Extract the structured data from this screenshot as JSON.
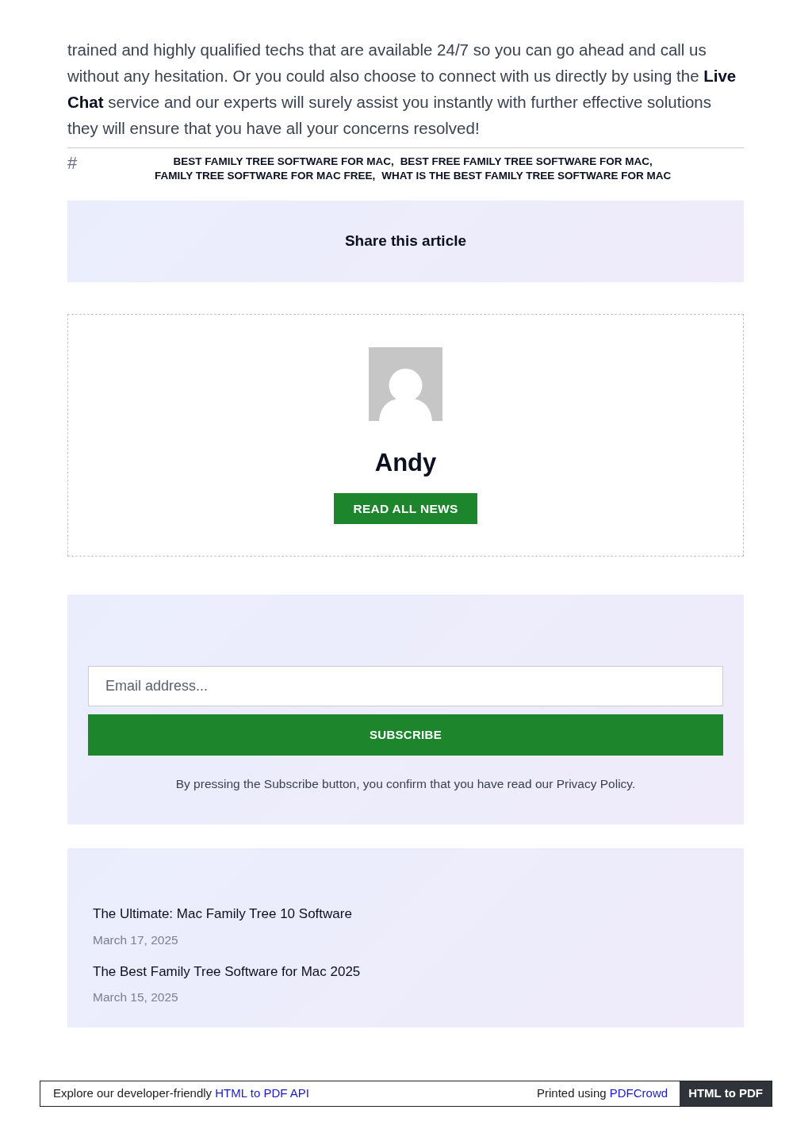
{
  "article": {
    "paragraph": "trained and highly qualified techs that are available 24/7 so you can go ahead and call us without any hesitation. Or you could also choose to connect with us directly by using the **Live Chat** service and our experts will surely assist you instantly with further effective solutions they will ensure that you have all your concerns resolved!",
    "tag_mark": "#",
    "tags": [
      "BEST FAMILY TREE SOFTWARE FOR MAC,",
      "BEST FREE FAMILY TREE SOFTWARE FOR MAC,",
      "FAMILY TREE SOFTWARE FOR MAC FREE,",
      "WHAT IS THE BEST FAMILY TREE SOFTWARE FOR MAC"
    ]
  },
  "share": {
    "title": "Share this article"
  },
  "author": {
    "name": "Andy",
    "button": "READ ALL NEWS"
  },
  "newsletter": {
    "placeholder": "Email address...",
    "button": "SUBSCRIBE",
    "note": "By pressing the Subscribe button, you confirm that you have read our Privacy Policy."
  },
  "recent_posts": [
    {
      "title": "The Ultimate: Mac Family Tree 10 Software",
      "date": "March 17, 2025"
    },
    {
      "title": "The Best Family Tree Software for Mac 2025",
      "date": "March 15, 2025"
    }
  ],
  "footer": {
    "left_text": "Explore our developer-friendly",
    "left_link": "HTML to PDF API",
    "right_text": "Printed using",
    "right_link": "PDFCrowd",
    "badge": "HTML to PDF"
  }
}
